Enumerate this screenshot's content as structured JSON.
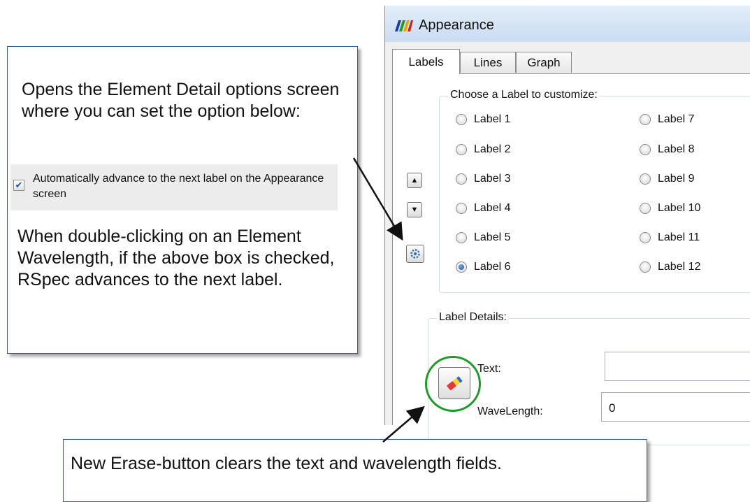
{
  "window": {
    "title": "Appearance",
    "tabs": [
      {
        "label": "Labels",
        "active": true
      },
      {
        "label": "Lines",
        "active": false
      },
      {
        "label": "Graph",
        "active": false
      }
    ],
    "label_group_title": "Choose a Label to customize:",
    "labels_col1": [
      "Label 1",
      "Label 2",
      "Label 3",
      "Label 4",
      "Label 5",
      "Label 6"
    ],
    "labels_col2": [
      "Label 7",
      "Label 8",
      "Label 9",
      "Label 10",
      "Label 11",
      "Label 12"
    ],
    "selected_label": "Label 6",
    "details_group_title": "Label Details:",
    "text_label": "Text:",
    "text_value": "",
    "wavelength_label": "WaveLength:",
    "wavelength_value": "0",
    "icons": {
      "app": "spectrum-icon",
      "up": "arrow-up-icon",
      "down": "arrow-down-icon",
      "settings": "gear-icon",
      "erase": "eraser-icon"
    }
  },
  "callout_top": {
    "intro": "Opens the Element Detail options screen where you can set the option below:",
    "option_text": "Automatically advance to the next label on the Appearance screen",
    "option_checked": true,
    "explanation": "When double-clicking on an Element Wavelength, if the above box is checked, RSpec advances to the next label."
  },
  "callout_bottom": {
    "text": "New Erase-button clears the text and wavelength fields."
  },
  "colors": {
    "callout_border": "#3e5f8a",
    "highlight_circle": "#1e9a2a",
    "radio_selected": "#1c4f9c"
  }
}
